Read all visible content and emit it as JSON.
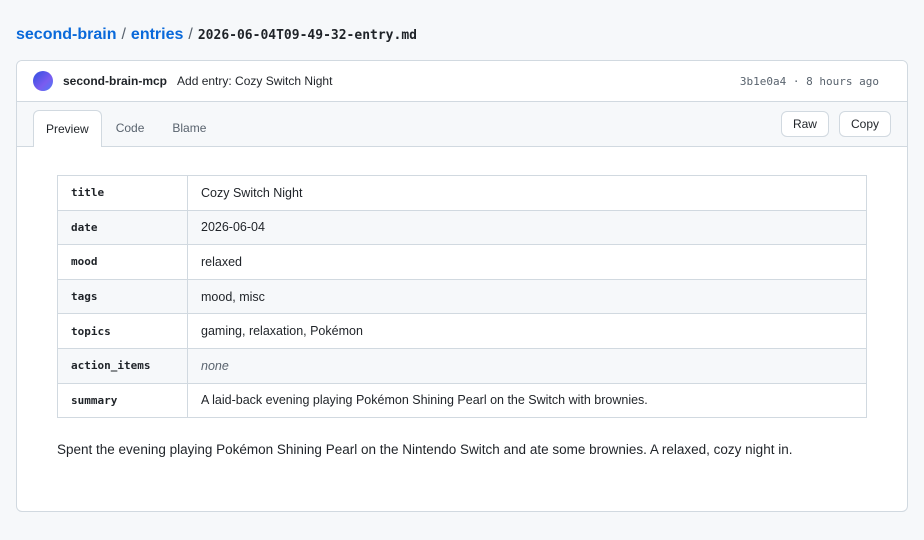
{
  "breadcrumb": {
    "repo": "second-brain",
    "folder": "entries",
    "separator": "/",
    "file": "2026-06-04T09-49-32-entry.md"
  },
  "commit": {
    "author": "second-brain-mcp",
    "message": "Add entry: Cozy Switch Night",
    "sha": "3b1e0a4",
    "dot": "·",
    "time": "8 hours ago"
  },
  "tabs": [
    {
      "label": "Preview",
      "active": true
    },
    {
      "label": "Code",
      "active": false
    },
    {
      "label": "Blame",
      "active": false
    }
  ],
  "actions": {
    "raw_label": "Raw",
    "copy_label": "Copy"
  },
  "frontmatter": [
    {
      "key": "title",
      "value": "Cozy Switch Night",
      "empty": false
    },
    {
      "key": "date",
      "value": "2026-06-04",
      "empty": false
    },
    {
      "key": "mood",
      "value": "relaxed",
      "empty": false
    },
    {
      "key": "tags",
      "value": "mood, misc",
      "empty": false
    },
    {
      "key": "topics",
      "value": "gaming, relaxation, Pokémon",
      "empty": false
    },
    {
      "key": "action_items",
      "value": "none",
      "empty": true
    },
    {
      "key": "summary",
      "value": "A laid-back evening playing Pokémon Shining Pearl on the Switch with brownies.",
      "empty": false
    }
  ],
  "body": "Spent the evening playing Pokémon Shining Pearl on the Nintendo Switch and ate some brownies. A relaxed, cozy night in.",
  "colors": {
    "link": "#0969da",
    "border": "#d1d9e0",
    "muted": "#59636e",
    "text": "#1f2328",
    "canvas_subtle": "#f6f8fa"
  }
}
